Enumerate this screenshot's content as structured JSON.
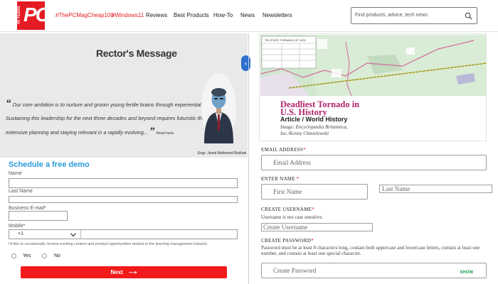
{
  "header": {
    "logo": {
      "years": "40 YEARS",
      "text": "PC",
      "color": "#e41b23"
    },
    "nav": [
      {
        "label": "#ThePCMagCheap100",
        "accent": true
      },
      {
        "label": "#Windows11",
        "accent": true
      },
      {
        "label": "Reviews",
        "accent": false
      },
      {
        "label": "Best Products",
        "accent": false
      },
      {
        "label": "How-To",
        "accent": false
      },
      {
        "label": "News",
        "accent": false
      },
      {
        "label": "Newsletters",
        "accent": false
      }
    ],
    "search": {
      "placeholder": "Find products, advice, tech news",
      "icon": "search-icon"
    }
  },
  "rector": {
    "title": "Rector's Message",
    "quote_lines": [
      "Our core ambition is to nurture and groom young fertile brains through experiential learning.",
      "Sustaining this leadership for the next three decades and beyond requires futuristic thinking,",
      "extensive planning and staying relevant in a rapidly evolving..."
    ],
    "read_more": "Read more",
    "caption": "Engr. Javed Mahmood Bukhari",
    "carousel_icon": "chevron-left-icon"
  },
  "demo_form": {
    "title": "Schedule a free demo",
    "fields": {
      "name_label": "Name",
      "last_name_label": "Last Name",
      "email_label": "Business E-mail*",
      "mobile_label": "Mobile*",
      "mobile_code": "+1"
    },
    "consent": "I'd like to occasionally receive exciting content and product opportunities related to the learning management industry",
    "radio_yes": "Yes",
    "radio_no": "No",
    "next_label": "Next"
  },
  "article": {
    "title_line1": "Deadliest Tornado in",
    "title_line2": "U.S. History",
    "subtitle": "Article / World History",
    "image_credit_1": "Image: Encyclopædia Britannica,",
    "image_credit_2": "Inc./Kenny Chmielewski",
    "map_caption": "TRI-STATE TORNADO OF 1925"
  },
  "signup_form": {
    "email_label": "EMAIL ADDRESS",
    "email_placeholder": "Email Address",
    "name_label": "ENTER NAME",
    "first_name_placeholder": "First Name",
    "last_name_placeholder": "Last Name",
    "username_label": "CREATE USERNAME",
    "username_help": "Username is not case sensitive.",
    "username_placeholder": "Create Username",
    "password_label": "CREATE PASSWORD",
    "password_help": "Password must be at least 8 characters long, contain both uppercase and lowercase letters, contain at least one number, and contain at least one special character.",
    "password_placeholder": "Create Password",
    "show_label": "SHOW",
    "required_mark": "*"
  },
  "colors": {
    "brand_red": "#e41b23",
    "demo_blue": "#2b9bdc",
    "article_magenta": "#b0246a",
    "show_green": "#1c9a4f"
  }
}
